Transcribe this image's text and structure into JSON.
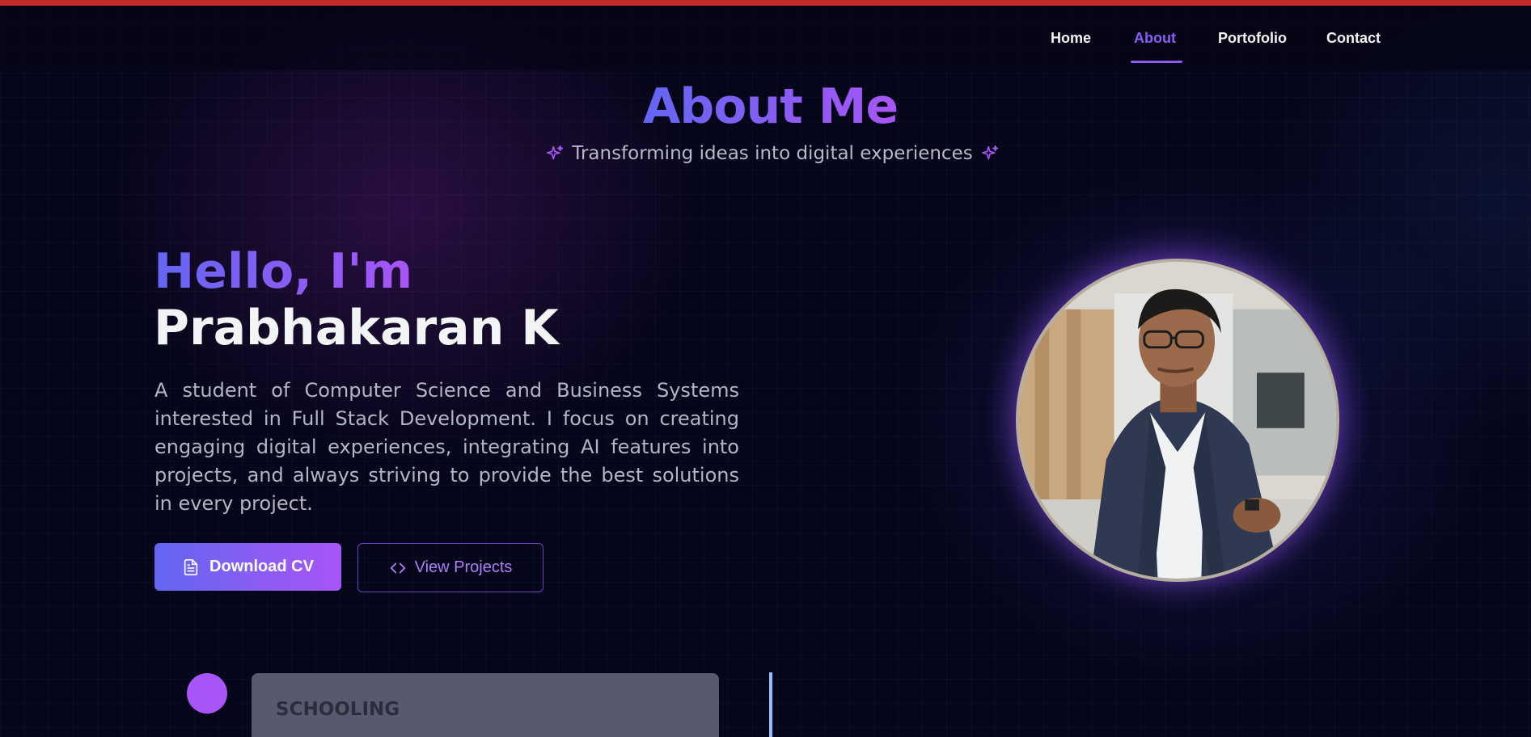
{
  "nav": {
    "items": [
      {
        "label": "Home"
      },
      {
        "label": "About"
      },
      {
        "label": "Portofolio"
      },
      {
        "label": "Contact"
      }
    ],
    "active": "About"
  },
  "header": {
    "title": "About Me",
    "subtitle": "Transforming ideas into digital experiences"
  },
  "intro": {
    "greeting": "Hello, I'm",
    "name": "Prabhakaran K",
    "bio": "A student of Computer Science and Business Systems interested in Full Stack Development. I focus on creating engaging digital experiences, integrating AI features into projects, and always striving to provide the best solutions in every project."
  },
  "buttons": {
    "download_cv": "Download CV",
    "view_projects": "View Projects"
  },
  "timeline": {
    "first_card_title": "SCHOOLING"
  },
  "colors": {
    "accent_start": "#6366f1",
    "accent_end": "#a855f7",
    "background": "#06061a",
    "top_bar": "#c42b2b",
    "timeline_line": "#8ec2ff"
  },
  "icons": {
    "sparkle": "sparkle-icon",
    "download_cv": "file-text-icon",
    "view_projects": "code-icon"
  }
}
